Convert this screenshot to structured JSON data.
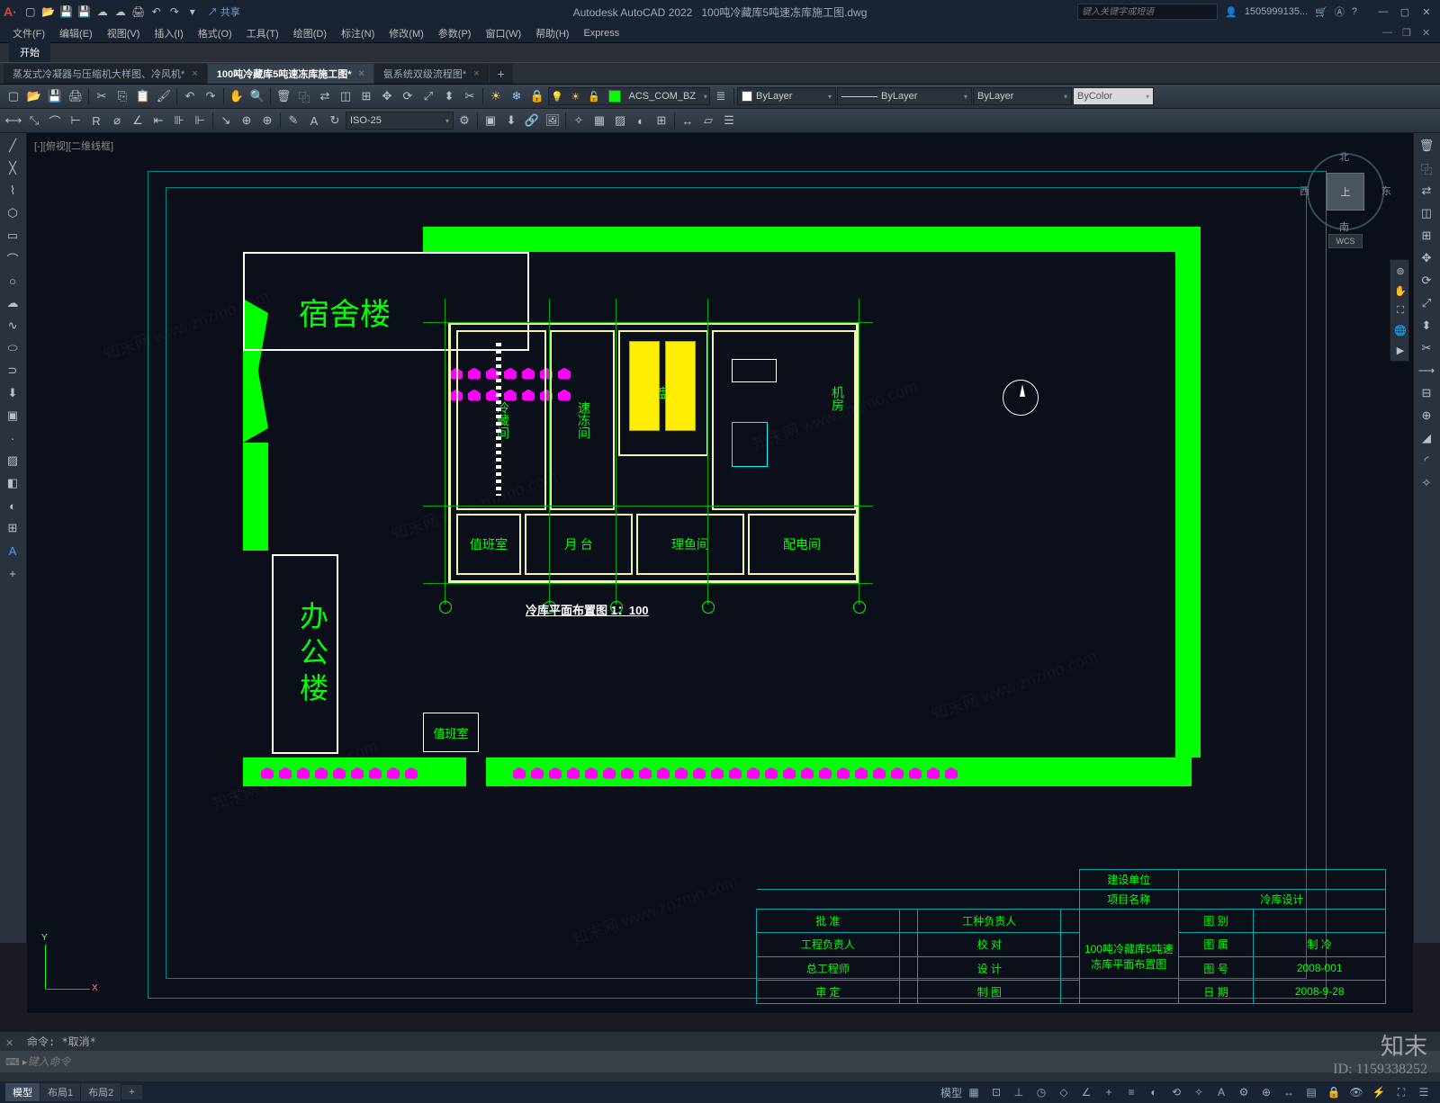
{
  "app": {
    "name": "Autodesk AutoCAD 2022",
    "document": "100吨冷藏库5吨速冻库施工图.dwg",
    "share": "共享"
  },
  "search": {
    "placeholder": "键入关键字或短语"
  },
  "user": {
    "name": "1505999135..."
  },
  "menubar": [
    "文件(F)",
    "编辑(E)",
    "视图(V)",
    "插入(I)",
    "格式(O)",
    "工具(T)",
    "绘图(D)",
    "标注(N)",
    "修改(M)",
    "参数(P)",
    "窗口(W)",
    "帮助(H)",
    "Express"
  ],
  "ribbonTabs": [
    "开始"
  ],
  "fileTabs": [
    {
      "label": "蒸发式冷凝器与压缩机大样图、冷风机*",
      "active": false
    },
    {
      "label": "100吨冷藏库5吨速冻库施工图*",
      "active": true
    },
    {
      "label": "氨系统双级流程图*",
      "active": false
    }
  ],
  "layerDropdown": {
    "swatch": "#00ff00",
    "name": "ACS_COM_BZ"
  },
  "propDropdowns": {
    "color": "ByLayer",
    "linetype": "ByLayer",
    "lineweight": "ByLayer",
    "plotstyle": "ByColor"
  },
  "dimStyle": "ISO-25",
  "viewport": {
    "label": "[-][俯视][二维线框]"
  },
  "viewcube": {
    "face": "上",
    "n": "北",
    "s": "南",
    "e": "东",
    "w": "西",
    "wcs": "WCS"
  },
  "drawing": {
    "planTitle": "冷库平面布置图  1：100",
    "buildings": {
      "dormitory": "宿舍楼",
      "office": "办公楼",
      "guard": "值班室"
    },
    "rooms": {
      "duty": "值班室",
      "platform": "月  台",
      "fish": "理鱼间",
      "power": "配电间",
      "coldStorage": "冷藏间",
      "quickFreeze": "速冻间",
      "ice": "脱盘间",
      "machine": "机房"
    },
    "titleBlock": {
      "construction_unit_label": "建设单位",
      "project_name_label": "项目名称",
      "project_name_value": "冷库设计",
      "approval": "批    准",
      "discipline_lead": "工种负责人",
      "eng_lead": "工程负责人",
      "checker": "校    对",
      "chief_eng": "总工程师",
      "designer": "设    计",
      "reviewer": "审    定",
      "drafter": "制    图",
      "dwg_title": "100吨冷藏库5吨速冻库平面布置图",
      "type_label": "图    别",
      "belong_label": "图    属",
      "belong_value": "制    冷",
      "num_label": "图    号",
      "num_value": "2008-001",
      "date_label": "日    期",
      "date_value": "2008-9-28"
    }
  },
  "command": {
    "history": "命令: *取消*",
    "placeholder": "键入命令"
  },
  "statusbar": {
    "tabs": [
      "模型",
      "布局1",
      "布局2"
    ],
    "plus": "+"
  },
  "ucs": {
    "x": "X",
    "y": "Y"
  },
  "watermark": {
    "brand": "知末",
    "id": "ID: 1159338252",
    "diag": "知末网 www.znzmo.com"
  }
}
